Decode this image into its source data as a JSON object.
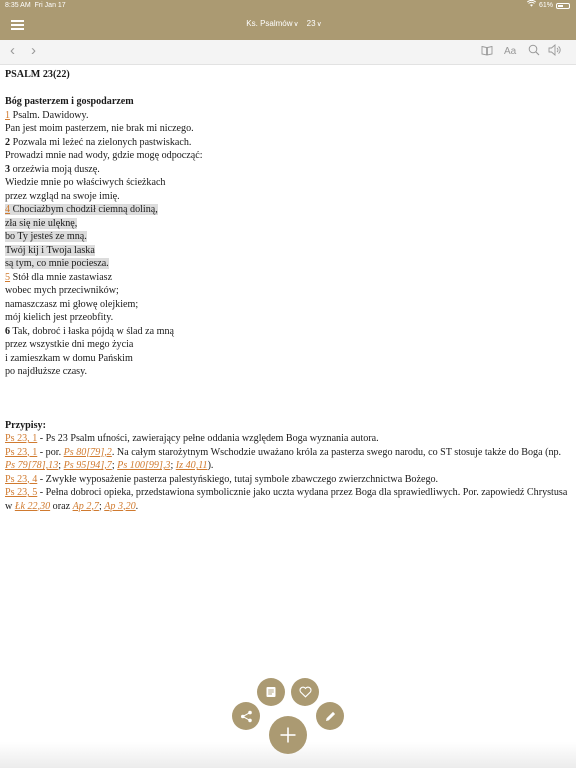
{
  "status": {
    "time": "8:35 AM",
    "date": "Fri Jan 17",
    "battery": "61%"
  },
  "nav": {
    "book": "Ks. Psalmów",
    "chapter": "23"
  },
  "toolbar": {
    "font_label": "Aa"
  },
  "psalm": {
    "heading": "PSALM 23(22)",
    "subtitle": "Bóg pasterzem i gospodarzem",
    "lines": [
      {
        "num": "1",
        "style": "link",
        "text": "Psalm. Dawidowy.",
        "hl": false
      },
      {
        "num": "",
        "style": "",
        "text": "Pan jest moim pasterzem, nie brak mi niczego.",
        "hl": false
      },
      {
        "num": "2",
        "style": "bold",
        "text": "Pozwala mi leżeć na zielonych pastwiskach.",
        "hl": false
      },
      {
        "num": "",
        "style": "",
        "text": "Prowadzi mnie nad wody, gdzie mogę odpocząć:",
        "hl": false
      },
      {
        "num": "3",
        "style": "bold",
        "text": "orzeźwia moją duszę.",
        "hl": false
      },
      {
        "num": "",
        "style": "",
        "text": "Wiedzie mnie po właściwych ścieżkach",
        "hl": false
      },
      {
        "num": "",
        "style": "",
        "text": "przez wzgląd na swoje imię.",
        "hl": false
      },
      {
        "num": "4",
        "style": "link",
        "text": "Chociażbym chodził ciemną doliną,",
        "hl": true
      },
      {
        "num": "",
        "style": "",
        "text": "zła się nie ulęknę,",
        "hl": true
      },
      {
        "num": "",
        "style": "",
        "text": "bo Ty jesteś ze mną.",
        "hl": true
      },
      {
        "num": "",
        "style": "",
        "text": "Twój kij i Twoja laska",
        "hl": true
      },
      {
        "num": "",
        "style": "",
        "text": "są tym, co mnie pociesza.",
        "hl": true
      },
      {
        "num": "5",
        "style": "link",
        "text": "Stół dla mnie zastawiasz",
        "hl": false
      },
      {
        "num": "",
        "style": "",
        "text": "wobec mych przeciwników;",
        "hl": false
      },
      {
        "num": "",
        "style": "",
        "text": "namaszczasz mi głowę olejkiem;",
        "hl": false
      },
      {
        "num": "",
        "style": "",
        "text": "mój kielich jest przeobfity.",
        "hl": false
      },
      {
        "num": "6",
        "style": "bold",
        "text": "Tak, dobroć i łaska pójdą w ślad za mną",
        "hl": false
      },
      {
        "num": "",
        "style": "",
        "text": "przez wszystkie dni mego życia",
        "hl": false
      },
      {
        "num": "",
        "style": "",
        "text": "i zamieszkam w domu Pańskim",
        "hl": false
      },
      {
        "num": "",
        "style": "",
        "text": "po najdłuższe czasy.",
        "hl": false
      }
    ]
  },
  "footnotes": {
    "heading": "Przypisy:",
    "items": [
      {
        "segs": [
          {
            "t": "ref",
            "v": "Ps 23, 1"
          },
          {
            "t": "text",
            "v": " - Ps 23 Psalm ufności, zawierający pełne oddania względem Boga wyznania autora."
          }
        ]
      },
      {
        "segs": [
          {
            "t": "ref",
            "v": "Ps 23, 1"
          },
          {
            "t": "text",
            "v": " - por. "
          },
          {
            "t": "link",
            "v": "Ps 80[79],2"
          },
          {
            "t": "text",
            "v": ". Na całym starożytnym Wschodzie uważano króla za pasterza swego narodu, co ST stosuje także do Boga (np. "
          },
          {
            "t": "link",
            "v": "Ps 79[78],13"
          },
          {
            "t": "text",
            "v": "; "
          },
          {
            "t": "link",
            "v": "Ps 95[94],7"
          },
          {
            "t": "text",
            "v": "; "
          },
          {
            "t": "link",
            "v": "Ps 100[99],3"
          },
          {
            "t": "text",
            "v": "; "
          },
          {
            "t": "link",
            "v": "Iz 40,11"
          },
          {
            "t": "text",
            "v": ")."
          }
        ]
      },
      {
        "segs": [
          {
            "t": "ref",
            "v": "Ps 23, 4"
          },
          {
            "t": "text",
            "v": " - Zwykłe wyposażenie pasterza palestyńskiego, tutaj symbole zbawczego zwierzchnictwa Bożego."
          }
        ]
      },
      {
        "segs": [
          {
            "t": "ref",
            "v": "Ps 23, 5"
          },
          {
            "t": "text",
            "v": " - Pełna dobroci opieka, przedstawiona symbolicznie jako uczta wydana przez Boga dla sprawiedliwych. Por. zapowiedź Chrystusa w "
          },
          {
            "t": "link",
            "v": "Łk 22,30"
          },
          {
            "t": "text",
            "v": " oraz "
          },
          {
            "t": "link",
            "v": "Ap 2,7"
          },
          {
            "t": "text",
            "v": "; "
          },
          {
            "t": "link",
            "v": "Ap 3,20"
          },
          {
            "t": "text",
            "v": "."
          }
        ]
      }
    ]
  },
  "colors": {
    "accent": "#ab9a72",
    "link": "#d07a2f",
    "highlight": "#dcdcdc"
  },
  "icons": {
    "top": [
      "menu-icon",
      "chevron-down-icon"
    ],
    "toolbar": [
      "back-arrow-icon",
      "forward-arrow-icon",
      "book-icon",
      "font-size-icon",
      "search-icon",
      "speaker-icon"
    ],
    "fab": [
      "note-icon",
      "heart-icon",
      "share-icon",
      "pencil-icon",
      "plus-icon"
    ]
  }
}
